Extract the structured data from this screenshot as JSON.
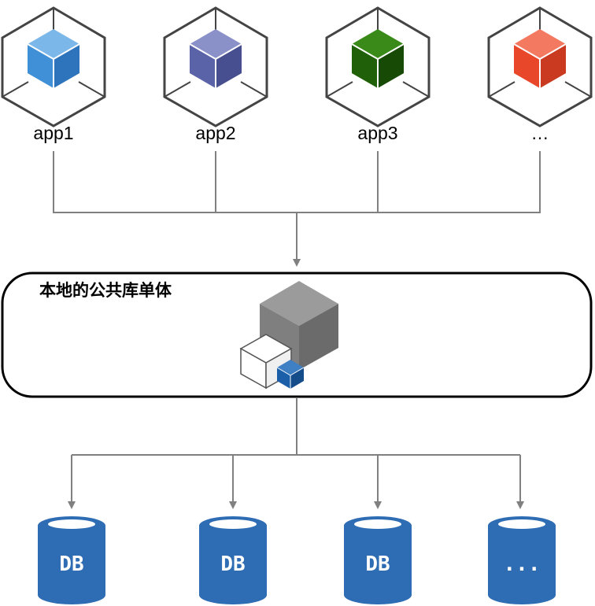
{
  "apps": [
    {
      "label": "app1",
      "color": "#4090d8"
    },
    {
      "label": "app2",
      "color": "#5a63a8"
    },
    {
      "label": "app3",
      "color": "#1f6008"
    },
    {
      "label": "…",
      "color": "#e8472a"
    }
  ],
  "library": {
    "title": "本地的公共库单体",
    "big_cube_color": "#7f7f7f",
    "small_cube_color": "#ffffff",
    "mini_cube_color": "#1a5fa8"
  },
  "databases": [
    {
      "label": "DB"
    },
    {
      "label": "DB"
    },
    {
      "label": "DB"
    },
    {
      "label": "..."
    }
  ],
  "colors": {
    "connector": "#808080",
    "db_fill": "#2e6db4",
    "outline": "#444444"
  }
}
